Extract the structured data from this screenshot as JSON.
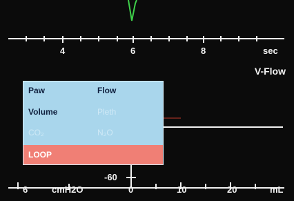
{
  "time_axis": {
    "ticks": [
      "4",
      "6",
      "8"
    ],
    "unit": "sec"
  },
  "waveform_title": "V-Flow",
  "menu": {
    "items": [
      {
        "label": "Paw",
        "enabled": true
      },
      {
        "label": "Flow",
        "enabled": true
      },
      {
        "label": "Volume",
        "enabled": true
      },
      {
        "label": "Pleth",
        "enabled": false
      },
      {
        "label": "CO₂",
        "enabled": false
      },
      {
        "label": "N₂O",
        "enabled": false
      }
    ],
    "selected": "LOOP"
  },
  "loop_axes": {
    "pressure_tick": "6",
    "pressure_unit": "cmH2O",
    "min_label": "-60",
    "volume_ticks": [
      "0",
      "10",
      "20"
    ],
    "volume_unit": "mL"
  },
  "colors": {
    "background": "#0b0b0b",
    "axis": "#f2f2f2",
    "waveform": "#3fd04a",
    "menu_bg": "#a9d6ec",
    "menu_selected": "#f07f75"
  }
}
